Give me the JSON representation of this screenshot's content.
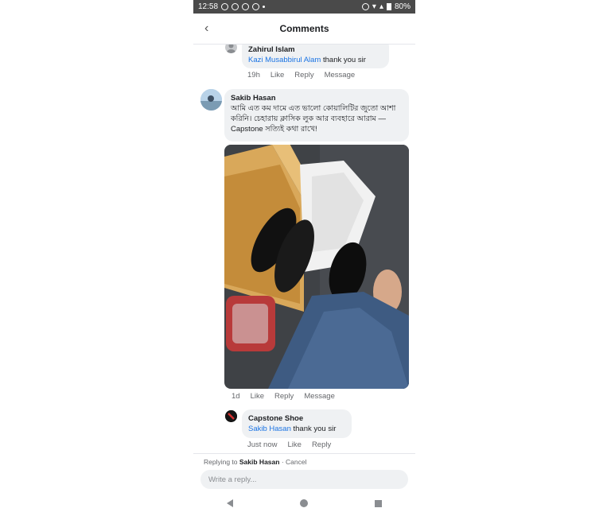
{
  "status_bar": {
    "time": "12:58",
    "battery": "80%"
  },
  "header": {
    "title": "Comments"
  },
  "comments": [
    {
      "author": "Zahirul Islam",
      "mention": "Kazi Musabbirul Alam",
      "text": " thank you sir",
      "time": "19h",
      "actions": [
        "Like",
        "Reply",
        "Message"
      ]
    },
    {
      "author": "Sakib Hasan",
      "text": "আমি এত কম দামে এত ভালো কোয়ালিটির জুতো আশা করিনি। চেহারায় ক্লাসিক লুক আর ব্যবহারে আরাম — Capstone সত্যিই কথা রাখে!",
      "time": "1d",
      "actions": [
        "Like",
        "Reply",
        "Message"
      ]
    },
    {
      "author": "Capstone Shoe",
      "mention": "Sakib Hasan",
      "text": " thank you sir",
      "time": "Just now",
      "actions": [
        "Like",
        "Reply"
      ]
    }
  ],
  "reply_bar": {
    "prefix": "Replying to ",
    "target": "Sakib Hasan",
    "cancel": " · Cancel",
    "placeholder": "Write a reply..."
  },
  "colors": {
    "mention": "#1b74e4",
    "bubble": "#eff1f3",
    "status_bar": "#4a4a4a"
  }
}
